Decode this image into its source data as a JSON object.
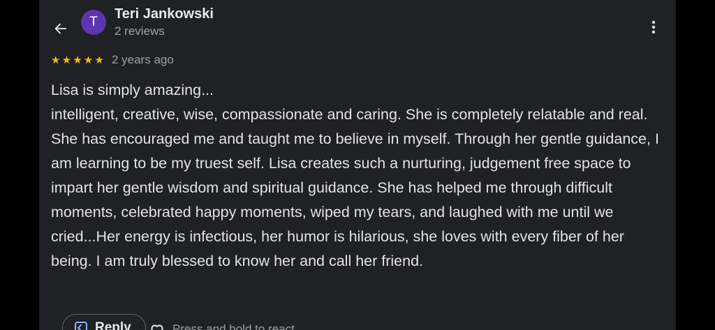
{
  "header": {
    "back_icon": "arrow-left-icon",
    "avatar_initial": "T",
    "avatar_color": "#5e35b1",
    "author_name": "Teri Jankowski",
    "author_meta": "2 reviews",
    "more_icon": "more-vertical-icon"
  },
  "review": {
    "rating": 5,
    "max_rating": 5,
    "star_color": "#fbbc04",
    "date": "2 years ago",
    "text": "Lisa is simply amazing...\nintelligent, creative, wise, compassionate and caring. She is completely relatable and real. She has encouraged me and taught me to believe in myself. Through her gentle guidance, I am learning to be my truest self. Lisa creates such a nurturing, judgement free space to impart her gentle wisdom and spiritual guidance. She has helped me through difficult moments, celebrated happy moments, wiped my tears, and laughed with me until we cried...Her energy is infectious, her humor is hilarious, she loves with every fiber of her being. I am truly blessed to know her and call her friend."
  },
  "actions": {
    "reply_icon": "reply-icon",
    "reply_label": "Reply",
    "heart_icon": "heart-outline-icon",
    "react_hint": "Press and hold to react"
  }
}
